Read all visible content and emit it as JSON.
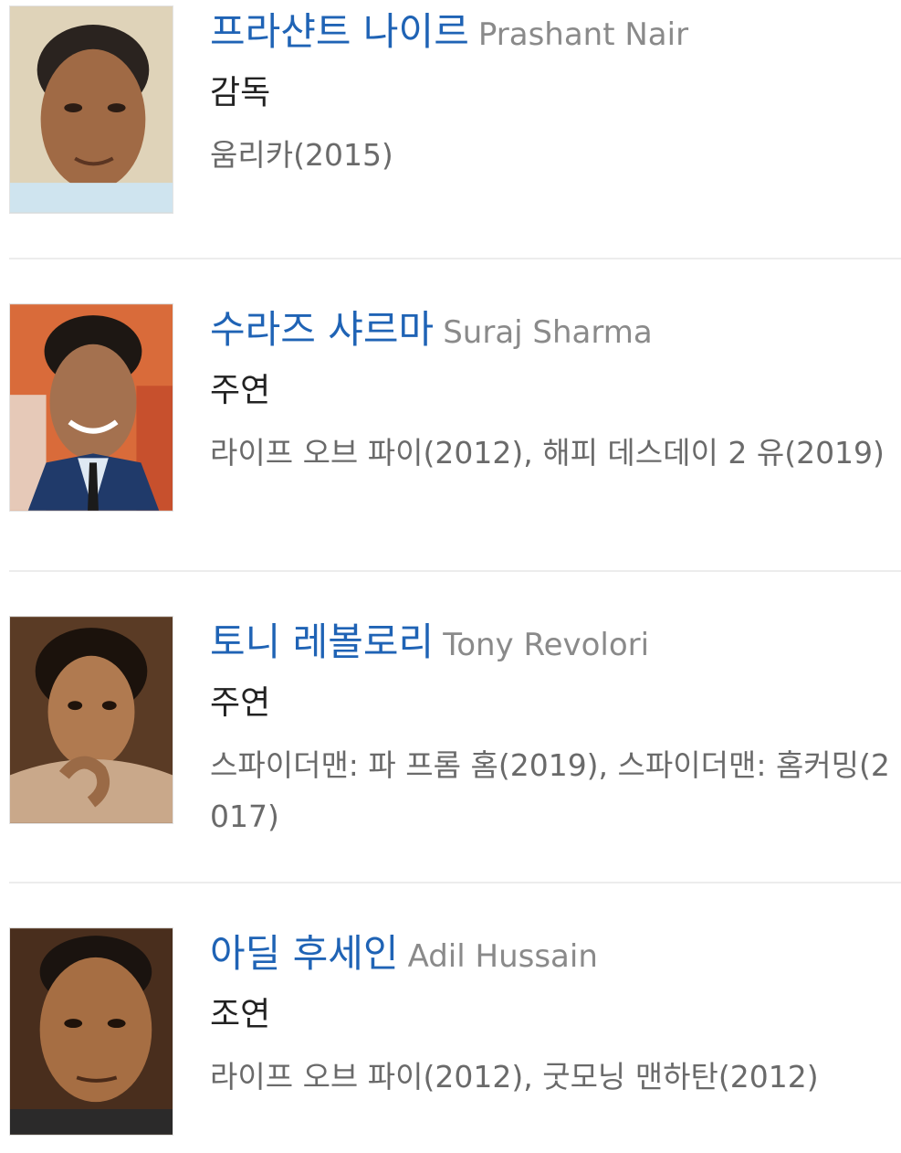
{
  "cast": [
    {
      "name_ko": "프라샨트 나이르",
      "name_en": "Prashant Nair",
      "role": "감독",
      "works": "움리카(2015)",
      "photo_icon": "person-photo"
    },
    {
      "name_ko": "수라즈 샤르마",
      "name_en": "Suraj Sharma",
      "role": "주연",
      "works": "라이프 오브 파이(2012), 해피 데스데이 2 유(2019)",
      "photo_icon": "person-photo"
    },
    {
      "name_ko": "토니 레볼로리",
      "name_en": "Tony Revolori",
      "role": "주연",
      "works": "스파이더맨: 파 프롬 홈(2019), 스파이더맨: 홈커밍(2017)",
      "photo_icon": "person-photo"
    },
    {
      "name_ko": "아딜 후세인",
      "name_en": "Adil Hussain",
      "role": "조연",
      "works": "라이프 오브 파이(2012), 굿모닝 맨하탄(2012)",
      "photo_icon": "person-photo"
    }
  ],
  "colors": {
    "name_ko": "#1f63b5",
    "name_en": "#8a8a8a",
    "role": "#222222",
    "works": "#6a6a6a",
    "divider": "#ececec"
  }
}
